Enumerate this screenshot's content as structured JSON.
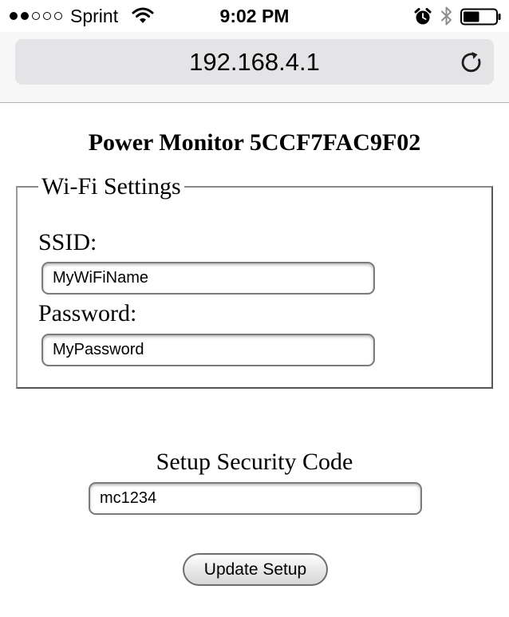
{
  "status_bar": {
    "signal_bars_filled": 2,
    "signal_bars_total": 5,
    "carrier": "Sprint",
    "time": "9:02 PM",
    "icons": [
      "wifi-icon",
      "alarm-icon",
      "bluetooth-icon",
      "battery-icon"
    ],
    "battery_level": 0.5
  },
  "address_bar": {
    "url": "192.168.4.1",
    "reload_icon": "reload-icon"
  },
  "page": {
    "title": "Power Monitor 5CCF7FAC9F02",
    "wifi_settings": {
      "legend": "Wi-Fi Settings",
      "ssid_label": "SSID:",
      "ssid_value": "MyWiFiName",
      "password_label": "Password:",
      "password_value": "MyPassword"
    },
    "security": {
      "label": "Setup Security Code",
      "value": "mc1234"
    },
    "submit_label": "Update Setup"
  },
  "colors": {
    "address_bar_bg": "#f7f7f7",
    "url_field_bg": "#e4e4e6",
    "page_bg": "#ffffff"
  }
}
